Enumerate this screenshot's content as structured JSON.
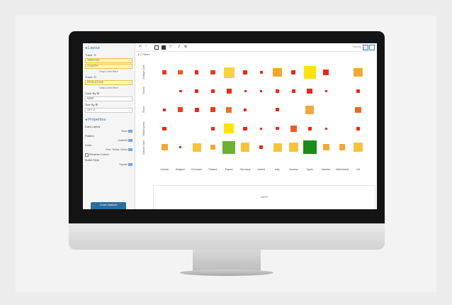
{
  "sidebar": {
    "layout_title": "Layout",
    "trace1_label": "Trace: ",
    "trace1_chips": [
      "TERRITORY",
      "COUNTRY"
    ],
    "drop_here": "Drop Level Here",
    "trace2_label": "Trace: ",
    "trace2_chips": [
      "PRODUCTLINE"
    ],
    "color_by_label": "Color By ",
    "color_by_value": "MSRP",
    "size_by_label": "Size By ",
    "size_by_value": "QTY. O",
    "properties_title": "Properties",
    "data_labels_label": "Data Labels",
    "data_labels_value": "None",
    "pattern_label": "Pattern",
    "pattern_value": "Gradient",
    "color_label": "Color",
    "color_value": "Red, Yellow, Green",
    "reverse_colors_label": "Reverse Colors",
    "bullet_style_label": "Bullet Style",
    "bullet_style_value": "Square",
    "chart_options_button": "Chart Options"
  },
  "toolbar": {
    "view_by_label": "View by"
  },
  "filters_label": "2 Filters",
  "heatmap": {
    "rows": [
      "Vintage Cars",
      "Trucks",
      "Ships",
      "Motorcycles",
      "Classic Cars"
    ],
    "columns": [
      "Austria",
      "Belgium",
      "Denmark",
      "Finland",
      "France",
      "Germany",
      "Ireland",
      "Italy",
      "Norway",
      "Spain",
      "Sweden",
      "Switzerland",
      "UK"
    ],
    "cells": [
      [
        {
          "size": 0.45,
          "color": "#e53a1c"
        },
        {
          "size": 0.45,
          "color": "#ea5a1f"
        },
        {
          "size": 0.35,
          "color": "#e62a1a"
        },
        {
          "size": 0.45,
          "color": "#e83d1c"
        },
        {
          "size": 1.0,
          "color": "#f7d23a"
        },
        {
          "size": 0.35,
          "color": "#e62a1a"
        },
        {
          "size": 0.25,
          "color": "#e62a1a"
        },
        {
          "size": 0.85,
          "color": "#f3a533"
        },
        {
          "size": 0.4,
          "color": "#e62a1a"
        },
        {
          "size": 1.15,
          "color": "#fbe30d"
        },
        {
          "size": 0.5,
          "color": "#e62a1a"
        },
        {
          "size": 0,
          "color": ""
        },
        {
          "size": 0.85,
          "color": "#f1a838"
        }
      ],
      [
        {
          "size": 0,
          "color": ""
        },
        {
          "size": 0.25,
          "color": "#e62a1a"
        },
        {
          "size": 0.35,
          "color": "#e62a1a"
        },
        {
          "size": 0.35,
          "color": "#e62a1a"
        },
        {
          "size": 0.45,
          "color": "#e62a1a"
        },
        {
          "size": 0.2,
          "color": "#e62a1a"
        },
        {
          "size": 0.2,
          "color": "#e62a1a"
        },
        {
          "size": 0.35,
          "color": "#e62a1a"
        },
        {
          "size": 0.35,
          "color": "#e62a1a"
        },
        {
          "size": 0.5,
          "color": "#e62a1a"
        },
        {
          "size": 0.2,
          "color": "#e62a1a"
        },
        {
          "size": 0,
          "color": ""
        },
        {
          "size": 0.3,
          "color": "#e62a1a"
        }
      ],
      [
        {
          "size": 0.3,
          "color": "#e62a1a"
        },
        {
          "size": 0.45,
          "color": "#e83d1c"
        },
        {
          "size": 0.4,
          "color": "#e62a1a"
        },
        {
          "size": 0.45,
          "color": "#e83d1c"
        },
        {
          "size": 0.5,
          "color": "#ee6d26"
        },
        {
          "size": 0.25,
          "color": "#e62a1a"
        },
        {
          "size": 0,
          "color": ""
        },
        {
          "size": 0.35,
          "color": "#e62a1a"
        },
        {
          "size": 0,
          "color": ""
        },
        {
          "size": 0.8,
          "color": "#f2a944"
        },
        {
          "size": 0,
          "color": ""
        },
        {
          "size": 0,
          "color": ""
        },
        {
          "size": 0.55,
          "color": "#ec6a23"
        }
      ],
      [
        {
          "size": 0.35,
          "color": "#e62a1a"
        },
        {
          "size": 0,
          "color": ""
        },
        {
          "size": 0,
          "color": ""
        },
        {
          "size": 0.35,
          "color": "#e62a1a"
        },
        {
          "size": 0.95,
          "color": "#fbe30d"
        },
        {
          "size": 0.35,
          "color": "#e62a1a"
        },
        {
          "size": 0.2,
          "color": "#e62a1a"
        },
        {
          "size": 0.3,
          "color": "#e62a1a"
        },
        {
          "size": 0.6,
          "color": "#ec5f22"
        },
        {
          "size": 0.35,
          "color": "#e62a1a"
        },
        {
          "size": 0.2,
          "color": "#e62a1a"
        },
        {
          "size": 0,
          "color": ""
        },
        {
          "size": 0.35,
          "color": "#e62a1a"
        }
      ],
      [
        {
          "size": 0.6,
          "color": "#f1a838"
        },
        {
          "size": 0.2,
          "color": "#e62a1a"
        },
        {
          "size": 0.8,
          "color": "#f6c43a"
        },
        {
          "size": 0.5,
          "color": "#f1a838"
        },
        {
          "size": 1.2,
          "color": "#6bb22e"
        },
        {
          "size": 0.85,
          "color": "#f6c43a"
        },
        {
          "size": 0.35,
          "color": "#e62a1a"
        },
        {
          "size": 0.8,
          "color": "#f6c43a"
        },
        {
          "size": 0.85,
          "color": "#f6c43a"
        },
        {
          "size": 1.25,
          "color": "#1a8c1a"
        },
        {
          "size": 0.6,
          "color": "#f1a838"
        },
        {
          "size": 0.55,
          "color": "#f1a838"
        },
        {
          "size": 0.85,
          "color": "#f6c43a"
        }
      ]
    ]
  },
  "panel2_label": "MSRP"
}
